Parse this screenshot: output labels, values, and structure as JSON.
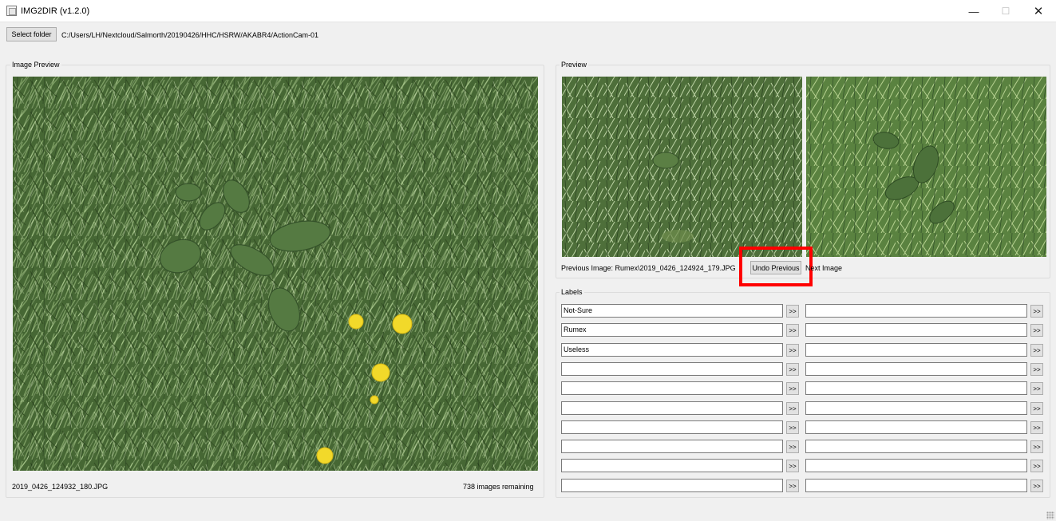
{
  "window": {
    "title": "IMG2DIR (v1.2.0)",
    "minimize_glyph": "—",
    "maximize_glyph": "☐",
    "close_glyph": "✕"
  },
  "toolbar": {
    "select_folder_label": "Select folder",
    "folder_path": "C:/Users/LH/Nextcloud/Salmorth/20190426/HHC/HSRW/AKABR4/ActionCam-01"
  },
  "image_preview": {
    "group_title": "Image Preview",
    "current_file": "2019_0426_124932_180.JPG",
    "remaining": "738 images remaining"
  },
  "preview": {
    "group_title": "Preview",
    "previous_image_label": "Previous Image: Rumex\\2019_0426_124924_179.JPG",
    "undo_label": "Undo Previous",
    "next_image_label": "Next Image"
  },
  "labels": {
    "group_title": "Labels",
    "arrow": ">>",
    "left": [
      "Not-Sure",
      "Rumex",
      "Useless",
      "",
      "",
      "",
      "",
      "",
      "",
      ""
    ],
    "right": [
      "",
      "",
      "",
      "",
      "",
      "",
      "",
      "",
      "",
      ""
    ]
  },
  "colors": {
    "highlight": "#ff0000",
    "grass_dark": "#2f4a24",
    "grass_light": "#8fae73",
    "dandelion": "#f2d92a"
  }
}
